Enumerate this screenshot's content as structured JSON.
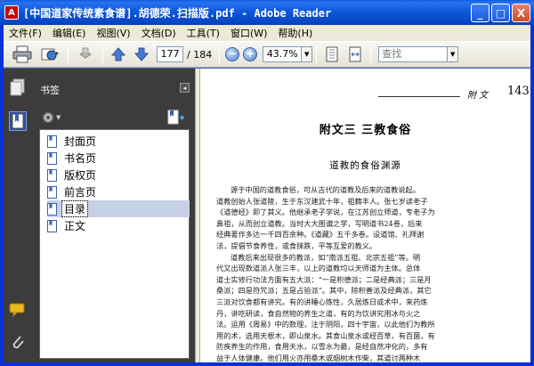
{
  "window": {
    "app_icon_letter": "A",
    "title": "[中国道家传统素食谱].胡德荣.扫描版.pdf - Adobe Reader",
    "minimize": "_",
    "maximize": "□",
    "close": "X"
  },
  "menu": [
    "文件(F)",
    "编辑(E)",
    "视图(V)",
    "文档(D)",
    "工具(T)",
    "窗口(W)",
    "帮助(H)"
  ],
  "toolbar": {
    "current_page": "177",
    "page_total": "/ 184",
    "zoom_out": "−",
    "zoom_in": "+",
    "zoom_level": "43.7%",
    "find_placeholder": "查找"
  },
  "bookmarks": {
    "title": "书签",
    "items": [
      {
        "label": "封面页",
        "selected": false
      },
      {
        "label": "书名页",
        "selected": false
      },
      {
        "label": "版权页",
        "selected": false
      },
      {
        "label": "前言页",
        "selected": false
      },
      {
        "label": "目录",
        "selected": true
      },
      {
        "label": "正文",
        "selected": false
      }
    ]
  },
  "document": {
    "header_text": "附    文",
    "page_number": "143",
    "title": "附文三    三教食俗",
    "subtitle": "道教的食俗渊源",
    "paragraphs": [
      "源于中国的道教食俗，可从古代的道教及后来的道教说起。",
      "道教创始人张道陵，生于东汉建武十年，祖籍丰人。张七岁读老子",
      "《道德经》即了其义。他继承老子学说，在江苏创立师道，专老子为",
      "鼻祖，从而创立道教。当时大大图谶之学，写明道书24卷，后来",
      "经典著作多达一千四百余种。《道藏》五千多卷。设道馆、礼拜谢",
      "法，提倡节食养性，或食抹跌，平等互爱的教义。",
      "道教后来出现很多的教派，如“南派五祖、北宗五祖”等。明",
      "代又出现数道派人张三丰，以上的道教均以天师道为主体。总体",
      "道士实修行功法方面有五大派：“一是积德派；二是经典派；三是月",
      "桑派；四是符咒派；五是占验派”。其中，除积善派及经典派，其它",
      "三派对饮食都有讲究。有的讲睡心炼性，久居炼日或术中，来药炼",
      "丹，讲吃研读，食自然物的养生之道，有的为饮讲究用冰与火之",
      "法。运用《周易》中的数理，注于阴阳，四十宇宙，以此他们为教所",
      "用的术，选用天根木，即山泉水。其食山泉水或经百草，有百菌，有",
      "防疾养生的作用，食用天水，以雪水为最，是经自然冲化的，多有",
      "益于人体健康。他们用火亦用桑木或烟树木作柴，其道讨两种木"
    ]
  }
}
